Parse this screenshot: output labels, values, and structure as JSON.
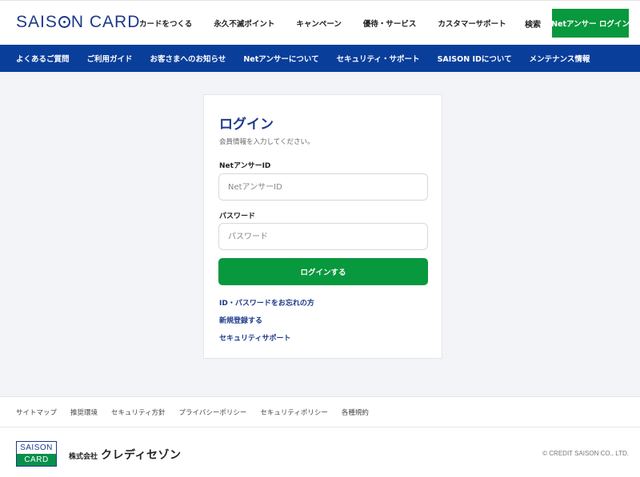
{
  "header": {
    "logo_text_a": "SAIS",
    "logo_text_b": "N CARD",
    "nav": [
      "カードをつくる",
      "永久不滅ポイント",
      "キャンペーン",
      "優待・サービス",
      "カスタマーサポート"
    ],
    "search_label": "検索",
    "login_label": "Netアンサー ログイン"
  },
  "sub_nav": [
    "よくあるご質問",
    "ご利用ガイド",
    "お客さまへのお知らせ",
    "Netアンサーについて",
    "セキュリティ・サポート",
    "SAISON IDについて",
    "メンテナンス情報"
  ],
  "login": {
    "title": "ログイン",
    "subtitle": "会員情報を入力してください。",
    "id_label": "NetアンサーID",
    "id_placeholder": "NetアンサーID",
    "password_label": "パスワード",
    "password_placeholder": "パスワード",
    "submit_label": "ログインする",
    "links": [
      "ID・パスワードをお忘れの方",
      "新規登録する",
      "セキュリティサポート"
    ]
  },
  "footer": {
    "links": [
      "サイトマップ",
      "推奨環境",
      "セキュリティ方針",
      "プライバシーポリシー",
      "セキュリティポリシー",
      "各種規約"
    ],
    "mark_top": "SAISON",
    "mark_bottom": "CARD",
    "company_prefix": "株式会社",
    "company_name": "クレディセゾン",
    "copyright": "© CREDIT SAISON CO., LTD."
  },
  "colors": {
    "brand_blue": "#1d3a8a",
    "nav_blue": "#0a3e9b",
    "accent_green": "#08983d"
  }
}
